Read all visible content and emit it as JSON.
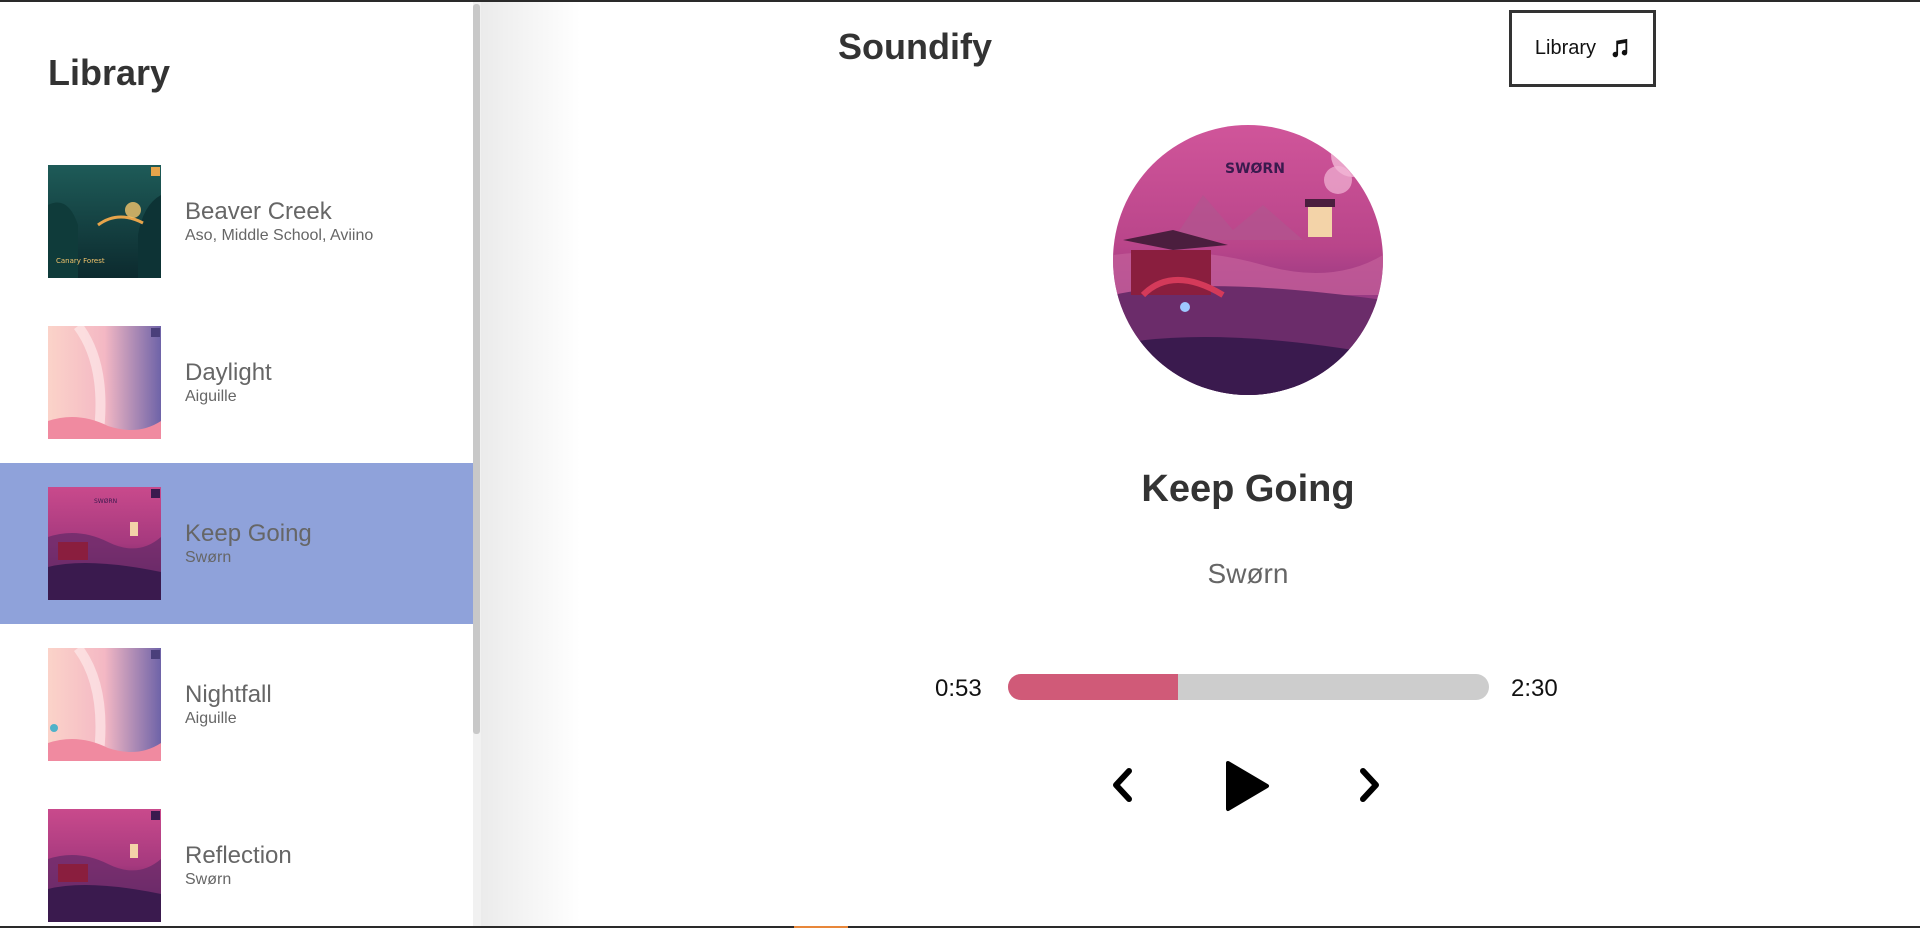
{
  "sidebar": {
    "title": "Library",
    "songs": [
      {
        "name": "Beaver Creek",
        "artist": "Aso, Middle School, Aviino",
        "active": false
      },
      {
        "name": "Daylight",
        "artist": "Aiguille",
        "active": false
      },
      {
        "name": "Keep Going",
        "artist": "Swørn",
        "active": true
      },
      {
        "name": "Nightfall",
        "artist": "Aiguille",
        "active": false
      },
      {
        "name": "Reflection",
        "artist": "Swørn",
        "active": false
      }
    ]
  },
  "header": {
    "app_title": "Soundify",
    "library_button_label": "Library",
    "library_button_icon": "music-note-icon"
  },
  "player": {
    "song_name": "Keep Going",
    "artist": "Swørn",
    "current_time": "0:53",
    "total_time": "2:30",
    "progress_fraction": 0.353,
    "progress_color": "#d05a78",
    "track_color": "#cdcdcd",
    "active_item_color": "#8fa2da",
    "controls": [
      "chevron-left-icon",
      "play-icon",
      "chevron-right-icon"
    ]
  }
}
